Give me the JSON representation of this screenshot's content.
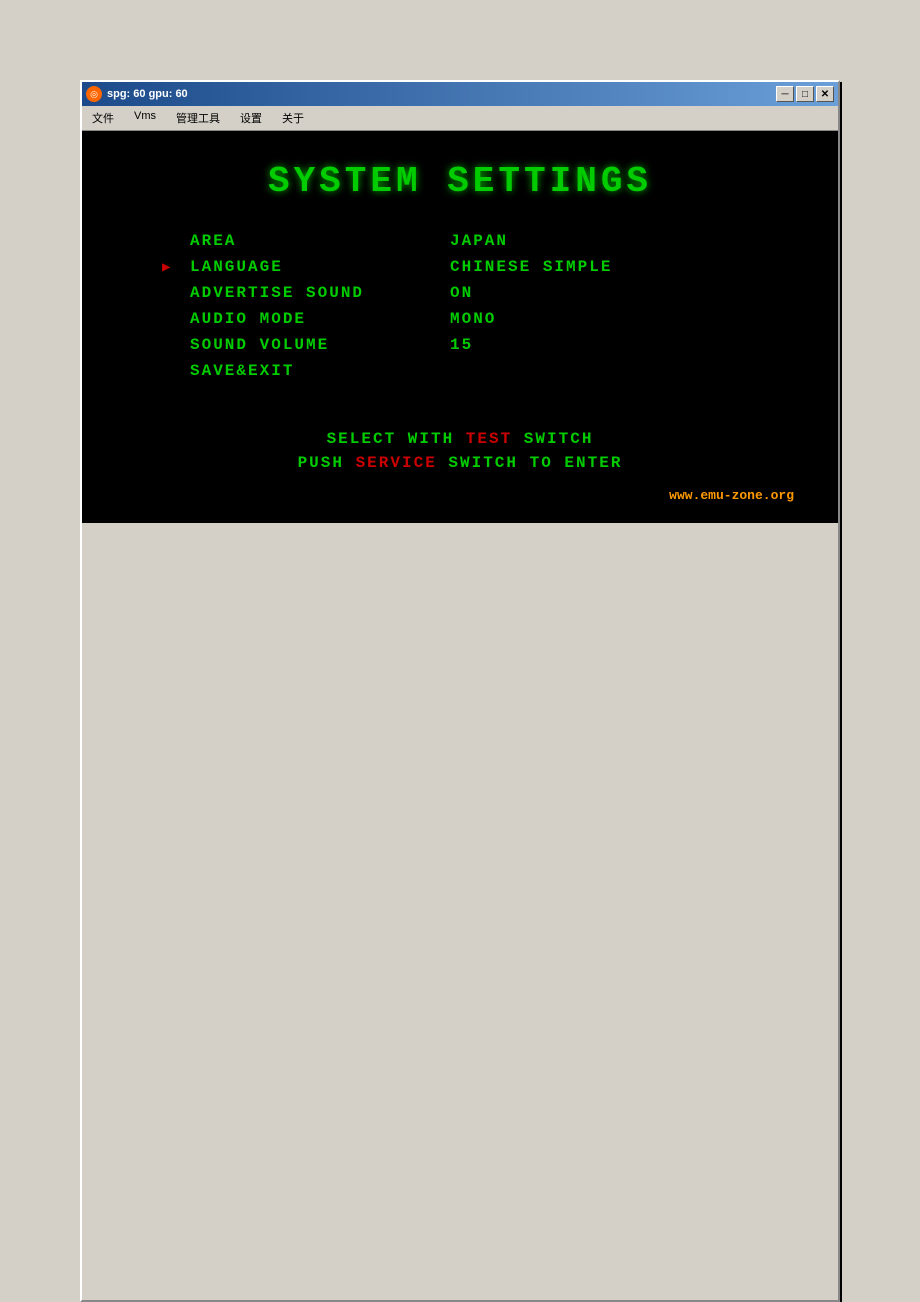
{
  "window": {
    "title": "spg: 60 gpu: 60",
    "title_icon": "●"
  },
  "title_buttons": {
    "minimize": "─",
    "maximize": "□",
    "close": "✕"
  },
  "menu": {
    "items": [
      "文件",
      "Vms",
      "管理工具",
      "设置",
      "关于"
    ]
  },
  "game": {
    "title": "SYSTEM  SETTINGS",
    "settings": [
      {
        "label": "AREA",
        "value": "JAPAN",
        "selected": false
      },
      {
        "label": "LANGUAGE",
        "value": "CHINESE SIMPLE",
        "selected": true
      },
      {
        "label": "ADVERTISE SOUND",
        "value": "ON",
        "selected": false
      },
      {
        "label": "AUDIO MODE",
        "value": "MONO",
        "selected": false
      },
      {
        "label": "SOUND VOLUME",
        "value": "15",
        "selected": false
      },
      {
        "label": "SAVE&EXIT",
        "value": "",
        "selected": false
      }
    ],
    "instructions": [
      {
        "parts": [
          {
            "text": "SELECT WITH ",
            "type": "normal"
          },
          {
            "text": "TEST",
            "type": "red"
          },
          {
            "text": " SWITCH",
            "type": "normal"
          }
        ]
      },
      {
        "parts": [
          {
            "text": "PUSH ",
            "type": "normal"
          },
          {
            "text": "SERVICE",
            "type": "red"
          },
          {
            "text": " SWITCH TO ENTER",
            "type": "normal"
          }
        ]
      }
    ],
    "watermark": "www.emu-zone.org"
  }
}
